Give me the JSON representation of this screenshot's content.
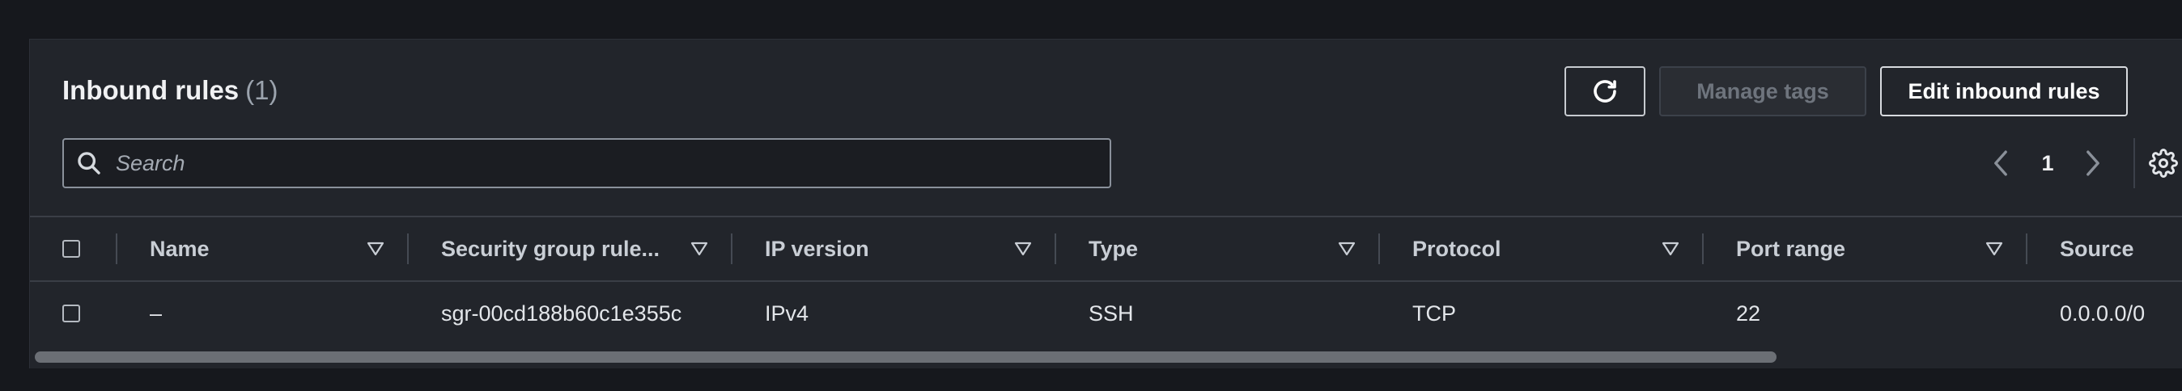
{
  "header": {
    "title": "Inbound rules",
    "count": "(1)"
  },
  "toolbar": {
    "refresh_icon": "refresh-icon",
    "manage_tags_label": "Manage tags",
    "edit_rules_label": "Edit inbound rules"
  },
  "search": {
    "placeholder": "Search",
    "value": ""
  },
  "pagination": {
    "current_page": "1",
    "prev_icon": "chevron-left-icon",
    "next_icon": "chevron-right-icon",
    "settings_icon": "gear-icon"
  },
  "table": {
    "columns": [
      "Name",
      "Security group rule...",
      "IP version",
      "Type",
      "Protocol",
      "Port range",
      "Source"
    ],
    "rows": [
      {
        "name": "–",
        "security_group_rule": "sgr-00cd188b60c1e355c",
        "ip_version": "IPv4",
        "type": "SSH",
        "protocol": "TCP",
        "port_range": "22",
        "source": "0.0.0.0/0"
      }
    ]
  },
  "colors": {
    "background": "#16181d",
    "panel": "#22252b",
    "text": "#e3e6ea",
    "muted": "#9ba3ad",
    "border": "#3a3e46"
  }
}
